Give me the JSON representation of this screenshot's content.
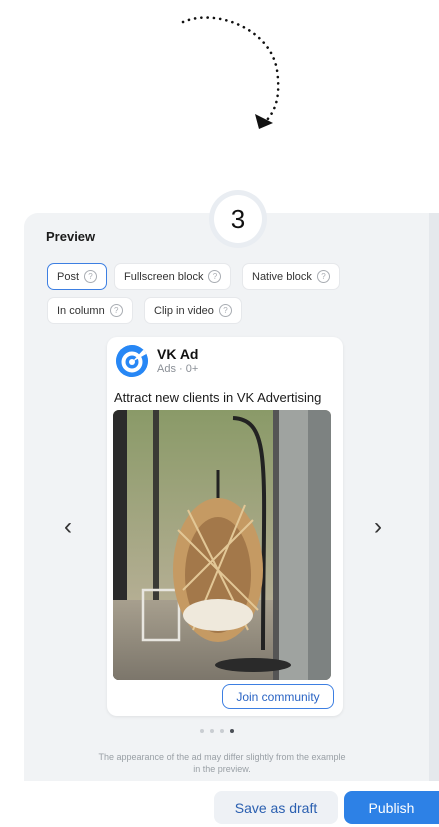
{
  "step": {
    "number": "3"
  },
  "preview": {
    "title": "Preview",
    "formats": [
      {
        "label": "Post",
        "active": true
      },
      {
        "label": "Fullscreen block",
        "active": false
      },
      {
        "label": "Native block",
        "active": false
      },
      {
        "label": "In column",
        "active": false
      },
      {
        "label": "Clip in video",
        "active": false
      }
    ],
    "help_glyph": "?"
  },
  "post": {
    "author": "VK Ad",
    "meta": "Ads · 0+",
    "text": "Attract new clients in VK Advertising",
    "image_alt": "Rattan hanging egg chair on a porch",
    "cta": "Join community"
  },
  "carousel": {
    "prev_glyph": "‹",
    "next_glyph": "›",
    "slide_count": 4,
    "active_index": 3
  },
  "disclaimer": "The appearance of the ad may differ slightly from the example in the preview.",
  "footer": {
    "draft_label": "Save as draft",
    "publish_label": "Publish"
  },
  "colors": {
    "accent": "#2d81e6",
    "panel_bg": "#f1f3f5"
  },
  "icons": [
    "curved-arrow-icon",
    "help-icon",
    "chevron-left-icon",
    "chevron-right-icon",
    "vk-ad-logo-icon"
  ]
}
